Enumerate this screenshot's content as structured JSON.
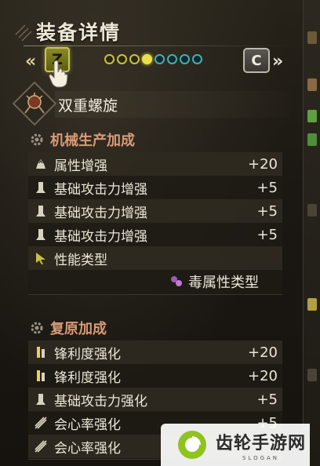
{
  "header": {
    "title": "装备详情",
    "left_arrow": "«",
    "left_key": "Z",
    "right_key": "C",
    "right_arrow": "»",
    "page_dots": {
      "total": 8,
      "active_index": 3,
      "yellow_count": 4
    }
  },
  "weapon": {
    "name": "双重螺旋",
    "icon": "insect-glaive-icon"
  },
  "sections": [
    {
      "title": "机械生产加成",
      "rows": [
        {
          "icon": "element-boost-icon",
          "label": "属性增强",
          "value": "+20"
        },
        {
          "icon": "attack-boost-icon",
          "label": "基础攻击力增强",
          "value": "+5"
        },
        {
          "icon": "attack-boost-icon",
          "label": "基础攻击力增强",
          "value": "+5"
        },
        {
          "icon": "attack-boost-icon",
          "label": "基础攻击力增强",
          "value": "+5"
        },
        {
          "icon": "type-arrow-icon",
          "label": "性能类型",
          "value": ""
        }
      ],
      "sub_value": {
        "icon": "poison-icon",
        "text": "毒属性类型"
      }
    },
    {
      "title": "复原加成",
      "rows": [
        {
          "icon": "sharpness-icon",
          "label": "锋利度强化",
          "value": "+20"
        },
        {
          "icon": "sharpness-icon",
          "label": "锋利度强化",
          "value": "+20"
        },
        {
          "icon": "attack-boost-icon",
          "label": "基础攻击力强化",
          "value": "+5"
        },
        {
          "icon": "affinity-icon",
          "label": "会心率强化",
          "value": "+5"
        },
        {
          "icon": "affinity-icon",
          "label": "会心率强化",
          "value": ""
        }
      ]
    }
  ],
  "watermark": {
    "name": "齿轮手游网",
    "slogan": "SLOGAN"
  },
  "colors": {
    "section_title": "#d89a76",
    "active_dot": "#e8e04a",
    "teal_dot": "#3fb0b3",
    "z_key": "#8a8a26"
  }
}
